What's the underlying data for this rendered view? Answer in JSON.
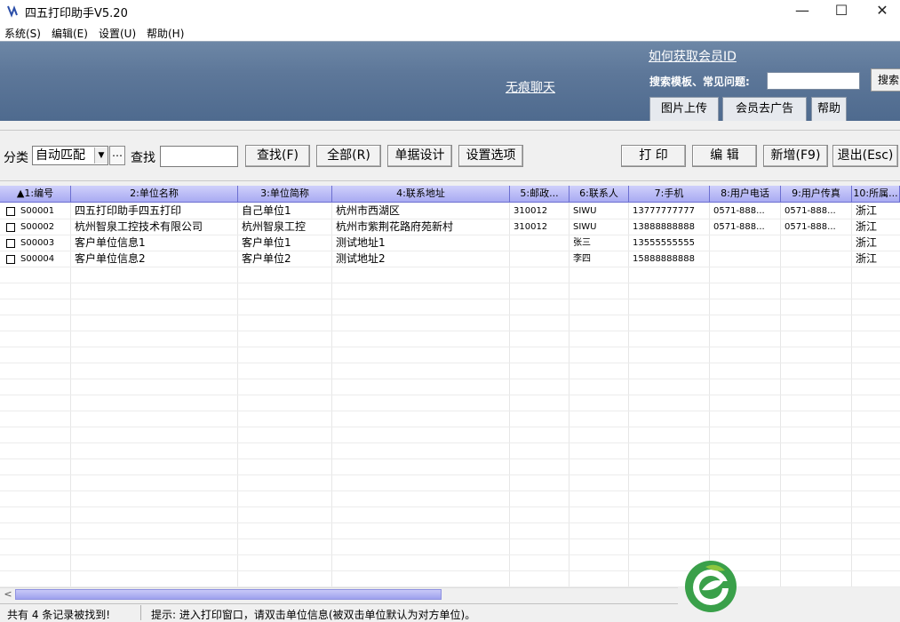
{
  "window": {
    "title": "四五打印助手V5.20",
    "minimize": "—",
    "maximize": "☐",
    "close": "✕"
  },
  "menu": [
    {
      "label": "系统(S)"
    },
    {
      "label": "编辑(E)"
    },
    {
      "label": "设置(U)"
    },
    {
      "label": "帮助(H)"
    }
  ],
  "banner": {
    "chat_link": "无痕聊天",
    "member_link": "如何获取会员ID",
    "search_label": "搜索模板、常见问题:",
    "search_value": "",
    "search_button": "搜索",
    "tabs": [
      "图片上传",
      "会员去广告",
      "帮助"
    ]
  },
  "toolbar": {
    "category_label": "分类",
    "category_value": "自动匹配",
    "category_more": "…",
    "find_label": "查找",
    "find_value": "",
    "buttons": [
      "查找(F)",
      "全部(R)",
      "单据设计",
      "设置选项"
    ],
    "right_buttons": [
      "打 印",
      "编 辑",
      "新增(F9)",
      "退出(Esc)"
    ]
  },
  "grid": {
    "columns": [
      "▲1:编号",
      "2:单位名称",
      "3:单位简称",
      "4:联系地址",
      "5:邮政...",
      "6:联系人",
      "7:手机",
      "8:用户电话",
      "9:用户传真",
      "10:所属..."
    ],
    "rows": [
      {
        "checked": false,
        "cells": [
          "S00001",
          "四五打印助手四五打印",
          "自己单位1",
          "杭州市西湖区",
          "310012",
          "SIWU",
          "13777777777",
          "0571-888...",
          "0571-888...",
          "浙江"
        ]
      },
      {
        "checked": false,
        "cells": [
          "S00002",
          "杭州智泉工控技术有限公司",
          "杭州智泉工控",
          "杭州市紫荆花路府苑新村",
          "310012",
          "SIWU",
          "13888888888",
          "0571-888...",
          "0571-888...",
          "浙江"
        ]
      },
      {
        "checked": false,
        "cells": [
          "S00003",
          "客户单位信息1",
          "客户单位1",
          "测试地址1",
          "",
          "张三",
          "13555555555",
          "",
          "",
          "浙江"
        ]
      },
      {
        "checked": false,
        "cells": [
          "S00004",
          "客户单位信息2",
          "客户单位2",
          "测试地址2",
          "",
          "李四",
          "15888888888",
          "",
          "",
          "浙江"
        ]
      }
    ]
  },
  "status": {
    "count": "共有 4 条记录被找到!",
    "tip": "提示: 进入打印窗口，请双击单位信息(被双击单位默认为对方单位)。"
  },
  "colors": {
    "header_blue": "#a9abf2",
    "banner": "#5d7799",
    "logo_green": "#3aa04a"
  },
  "icons": [
    "app-icon",
    "checkbox-icon",
    "scroll-left-icon",
    "brand-logo-icon"
  ]
}
